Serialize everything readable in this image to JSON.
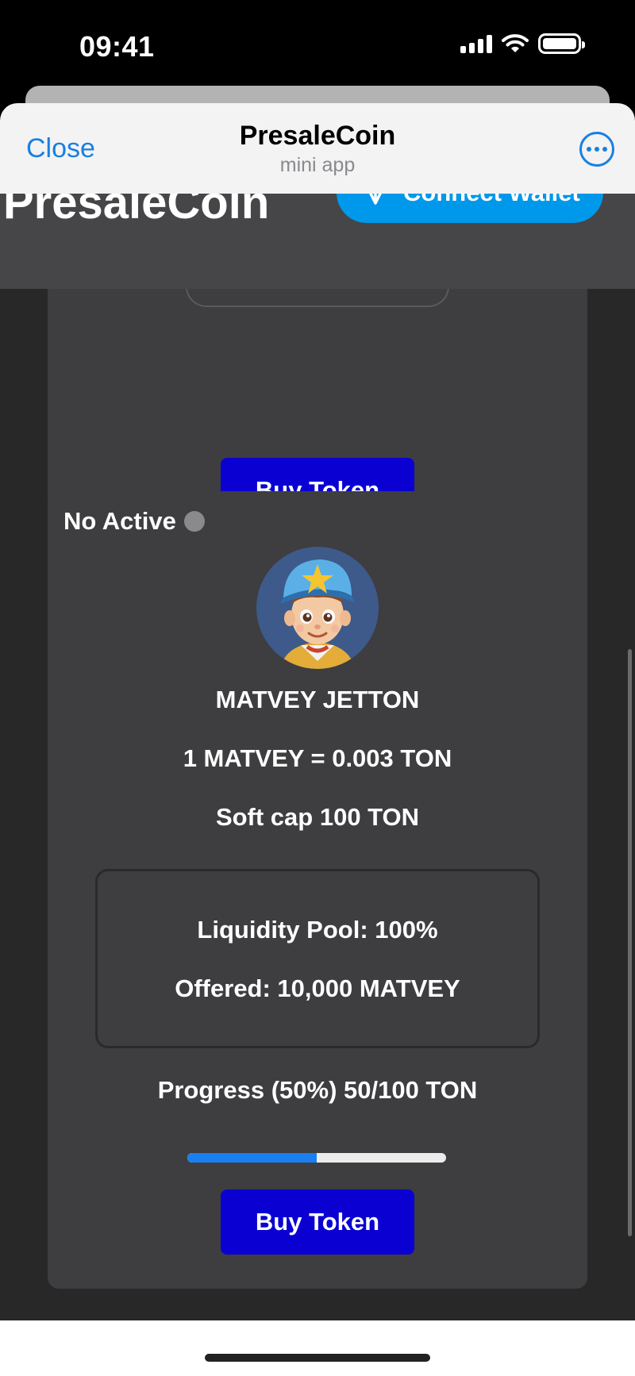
{
  "status_bar": {
    "time": "09:41"
  },
  "nav": {
    "close_label": "Close",
    "title": "PresaleCoin",
    "subtitle": "mini app"
  },
  "header": {
    "brand": "PresaleCoin",
    "connect_label": "Connect Wallet"
  },
  "presales": [
    {
      "buy_label": "Buy Token"
    },
    {
      "status": "No Active",
      "name": "MATVEY JETTON",
      "price": "1 MATVEY = 0.003 TON",
      "soft_cap": "Soft cap 100 TON",
      "liquidity": "Liquidity Pool: 100%",
      "offered": "Offered: 10,000 MATVEY",
      "progress_label": "Progress (50%) 50/100 TON",
      "progress_fraction": 0.5,
      "buy_label": "Buy Token"
    }
  ],
  "colors": {
    "accent": "#0098ea",
    "buy_button": "#0a00d2",
    "link": "#1a7fe0",
    "progress": "#1a7ff2",
    "inactive_dot": "#8a8a8c"
  },
  "icons": [
    "ton-logo-icon",
    "more-icon",
    "wifi-icon",
    "signal-icon",
    "battery-icon"
  ]
}
